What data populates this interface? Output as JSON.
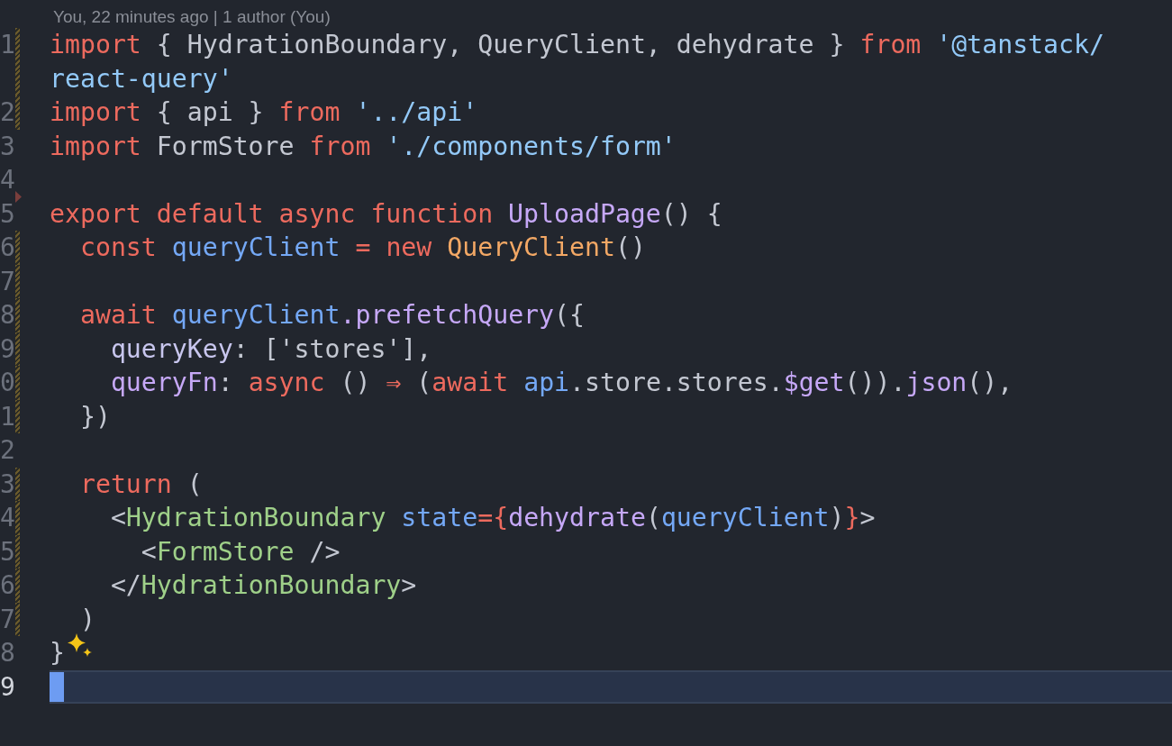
{
  "blame": {
    "text": "You, 22 minutes ago | 1 author (You)"
  },
  "lines": [
    {
      "number": "1",
      "modified": true,
      "deleted": false,
      "current": false,
      "hint": false,
      "tokens": [
        {
          "kind": "kw",
          "text": "import"
        },
        {
          "kind": "p",
          "text": " { HydrationBoundary, QueryClient, dehydrate } "
        },
        {
          "kind": "kw",
          "text": "from"
        },
        {
          "kind": "str",
          "text": " '@tanstack/react-query'"
        }
      ]
    },
    {
      "number": "2",
      "modified": true,
      "deleted": false,
      "current": false,
      "hint": false,
      "tokens": [
        {
          "kind": "kw",
          "text": "import"
        },
        {
          "kind": "p",
          "text": " { api } "
        },
        {
          "kind": "kw",
          "text": "from"
        },
        {
          "kind": "str",
          "text": " '../api'"
        }
      ]
    },
    {
      "number": "3",
      "modified": false,
      "deleted": false,
      "current": false,
      "hint": false,
      "tokens": [
        {
          "kind": "kw",
          "text": "import"
        },
        {
          "kind": "p",
          "text": " FormStore "
        },
        {
          "kind": "kw",
          "text": "from"
        },
        {
          "kind": "str",
          "text": " './components/form'"
        }
      ]
    },
    {
      "number": "4",
      "modified": false,
      "deleted": false,
      "current": false,
      "hint": false
    },
    {
      "number": "5",
      "modified": false,
      "deleted": true,
      "current": false,
      "hint": false,
      "tokens": [
        {
          "kind": "kw",
          "text": "export default async function"
        },
        {
          "kind": "fn",
          "text": " UploadPage"
        },
        {
          "kind": "p",
          "text": "() {"
        }
      ]
    },
    {
      "number": "6",
      "modified": true,
      "deleted": false,
      "current": false,
      "hint": false,
      "tokens": [
        {
          "kind": "kw",
          "text": "  const"
        },
        {
          "kind": "var",
          "text": " queryClient"
        },
        {
          "kind": "kw",
          "text": " = new"
        },
        {
          "kind": "cls",
          "text": " QueryClient"
        },
        {
          "kind": "p",
          "text": "()"
        }
      ]
    },
    {
      "number": "7",
      "modified": true,
      "deleted": false,
      "current": false,
      "hint": false
    },
    {
      "number": "8",
      "modified": true,
      "deleted": false,
      "current": false,
      "hint": false,
      "tokens": [
        {
          "kind": "kw",
          "text": "  await"
        },
        {
          "kind": "var",
          "text": " queryClient"
        },
        {
          "kind": "fn",
          "text": ".prefetchQuery"
        },
        {
          "kind": "p",
          "text": "({"
        }
      ]
    },
    {
      "number": "9",
      "modified": true,
      "deleted": false,
      "current": false,
      "hint": false,
      "tokens": [
        {
          "kind": "prop",
          "text": "    queryKey"
        },
        {
          "kind": "p",
          "text": ": ['stores'],"
        }
      ]
    },
    {
      "number": "0",
      "modified": true,
      "deleted": false,
      "current": false,
      "hint": false,
      "tokens": [
        {
          "kind": "fn",
          "text": "    queryFn"
        },
        {
          "kind": "p",
          "text": ": "
        },
        {
          "kind": "kw",
          "text": "async"
        },
        {
          "kind": "p",
          "text": " () "
        },
        {
          "kind": "kw",
          "text": "⇒"
        },
        {
          "kind": "p",
          "text": " ("
        },
        {
          "kind": "kw",
          "text": "await"
        },
        {
          "kind": "var",
          "text": " api"
        },
        {
          "kind": "p",
          "text": ".store.stores."
        },
        {
          "kind": "fn",
          "text": "$get"
        },
        {
          "kind": "p",
          "text": "())."
        },
        {
          "kind": "fn",
          "text": "json"
        },
        {
          "kind": "p",
          "text": "(),"
        }
      ]
    },
    {
      "number": "1",
      "modified": true,
      "deleted": false,
      "current": false,
      "hint": false,
      "tokens": [
        {
          "kind": "p",
          "text": "  })"
        }
      ]
    },
    {
      "number": "2",
      "modified": false,
      "deleted": false,
      "current": false,
      "hint": false
    },
    {
      "number": "3",
      "modified": true,
      "deleted": false,
      "current": false,
      "hint": false,
      "tokens": [
        {
          "kind": "kw",
          "text": "  return"
        },
        {
          "kind": "p",
          "text": " ("
        }
      ]
    },
    {
      "number": "4",
      "modified": true,
      "deleted": false,
      "current": false,
      "hint": false,
      "tokens": [
        {
          "kind": "p",
          "text": "    <"
        },
        {
          "kind": "tag",
          "text": "HydrationBoundary"
        },
        {
          "kind": "var",
          "text": " state"
        },
        {
          "kind": "kw",
          "text": "={"
        },
        {
          "kind": "fn",
          "text": "dehydrate"
        },
        {
          "kind": "p",
          "text": "("
        },
        {
          "kind": "var",
          "text": "queryClient"
        },
        {
          "kind": "p",
          "text": ")"
        },
        {
          "kind": "kw",
          "text": "}"
        },
        {
          "kind": "p",
          "text": ">"
        }
      ]
    },
    {
      "number": "5",
      "modified": true,
      "deleted": false,
      "current": false,
      "hint": false,
      "tokens": [
        {
          "kind": "p",
          "text": "      <"
        },
        {
          "kind": "tag",
          "text": "FormStore"
        },
        {
          "kind": "p",
          "text": " />"
        }
      ]
    },
    {
      "number": "6",
      "modified": true,
      "deleted": false,
      "current": false,
      "hint": false,
      "tokens": [
        {
          "kind": "p",
          "text": "    </"
        },
        {
          "kind": "tag",
          "text": "HydrationBoundary"
        },
        {
          "kind": "p",
          "text": ">"
        }
      ]
    },
    {
      "number": "7",
      "modified": true,
      "deleted": false,
      "current": false,
      "hint": false,
      "tokens": [
        {
          "kind": "p",
          "text": "  )"
        }
      ]
    },
    {
      "number": "8",
      "modified": false,
      "deleted": false,
      "current": false,
      "hint": true,
      "tokens": [
        {
          "kind": "p",
          "text": "}"
        }
      ]
    },
    {
      "number": "9",
      "modified": false,
      "deleted": false,
      "current": true,
      "hint": false
    }
  ]
}
